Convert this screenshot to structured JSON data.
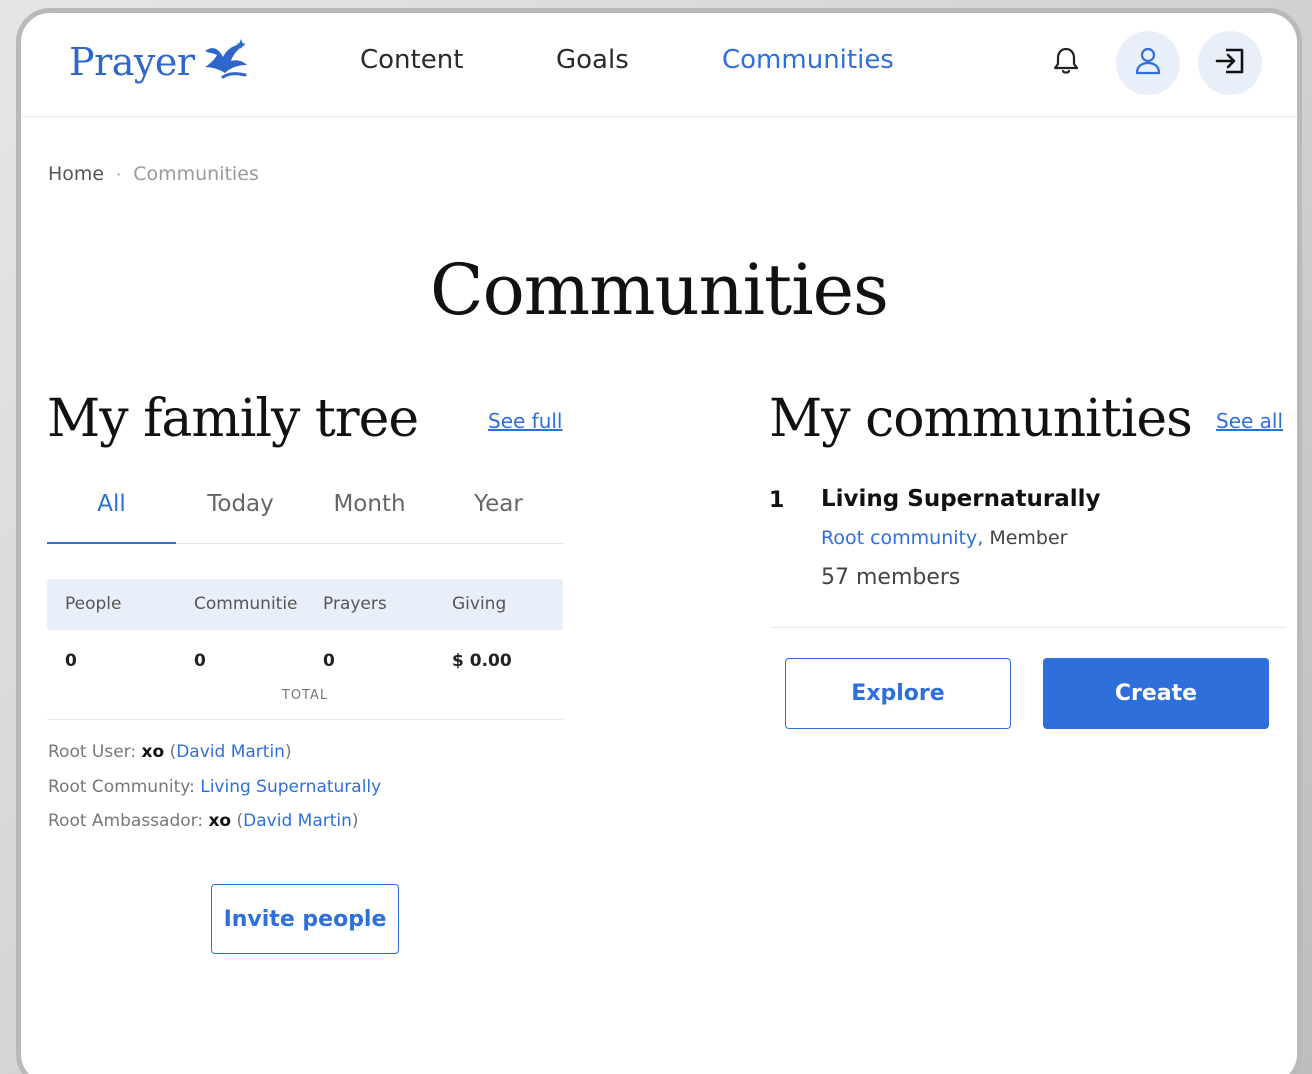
{
  "header": {
    "brand": "Prayer",
    "nav": [
      {
        "label": "Content",
        "active": false
      },
      {
        "label": "Goals",
        "active": false
      },
      {
        "label": "Communities",
        "active": true
      }
    ],
    "icons": [
      "bell-icon",
      "user-icon",
      "logout-icon"
    ]
  },
  "breadcrumb": {
    "home": "Home",
    "separator": "·",
    "current": "Communities"
  },
  "page": {
    "title": "Communities"
  },
  "family_tree": {
    "title": "My family tree",
    "see_full": "See full",
    "tabs": [
      "All",
      "Today",
      "Month",
      "Year"
    ],
    "active_tab": "All",
    "columns": [
      "People",
      "Communitie",
      "Prayers",
      "Giving"
    ],
    "values": [
      "0",
      "0",
      "0",
      "$ 0.00"
    ],
    "total_label": "TOTAL",
    "root_user": {
      "label": "Root User:",
      "name": "xo",
      "link": "David Martin"
    },
    "root_community": {
      "label": "Root Community:",
      "link": "Living Supernaturally"
    },
    "root_ambassador": {
      "label": "Root Ambassador:",
      "name": "xo",
      "link": "David Martin"
    },
    "invite_button": "Invite people"
  },
  "my_communities": {
    "title": "My communities",
    "see_all": "See all",
    "items": [
      {
        "rank": "1",
        "name": "Living Supernaturally",
        "type_link": "Root community,",
        "role": "Member",
        "members": "57 members"
      }
    ],
    "explore_button": "Explore",
    "create_button": "Create"
  },
  "colors": {
    "accent": "#2f6fdb",
    "header_fill": "#e9eff9"
  }
}
